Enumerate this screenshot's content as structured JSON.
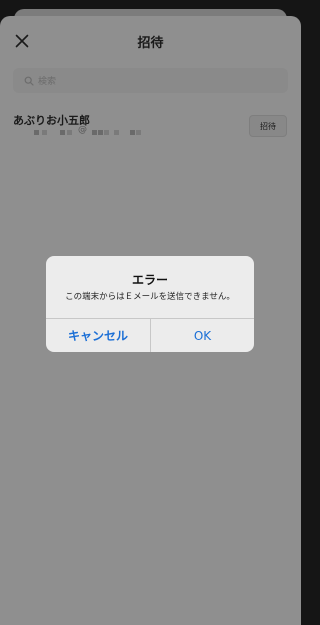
{
  "header": {
    "title": "招待"
  },
  "search": {
    "placeholder": "検索"
  },
  "contact": {
    "name": "あぶりお小五郎",
    "invite_label": "招待"
  },
  "alert": {
    "title": "エラー",
    "message": "この端末からはＥメールを送信できません。",
    "cancel_label": "キャンセル",
    "ok_label": "OK"
  },
  "colors": {
    "accent": "#1b6fd6",
    "overlay_background": "#8f8f8f",
    "alert_background": "#ececec"
  }
}
